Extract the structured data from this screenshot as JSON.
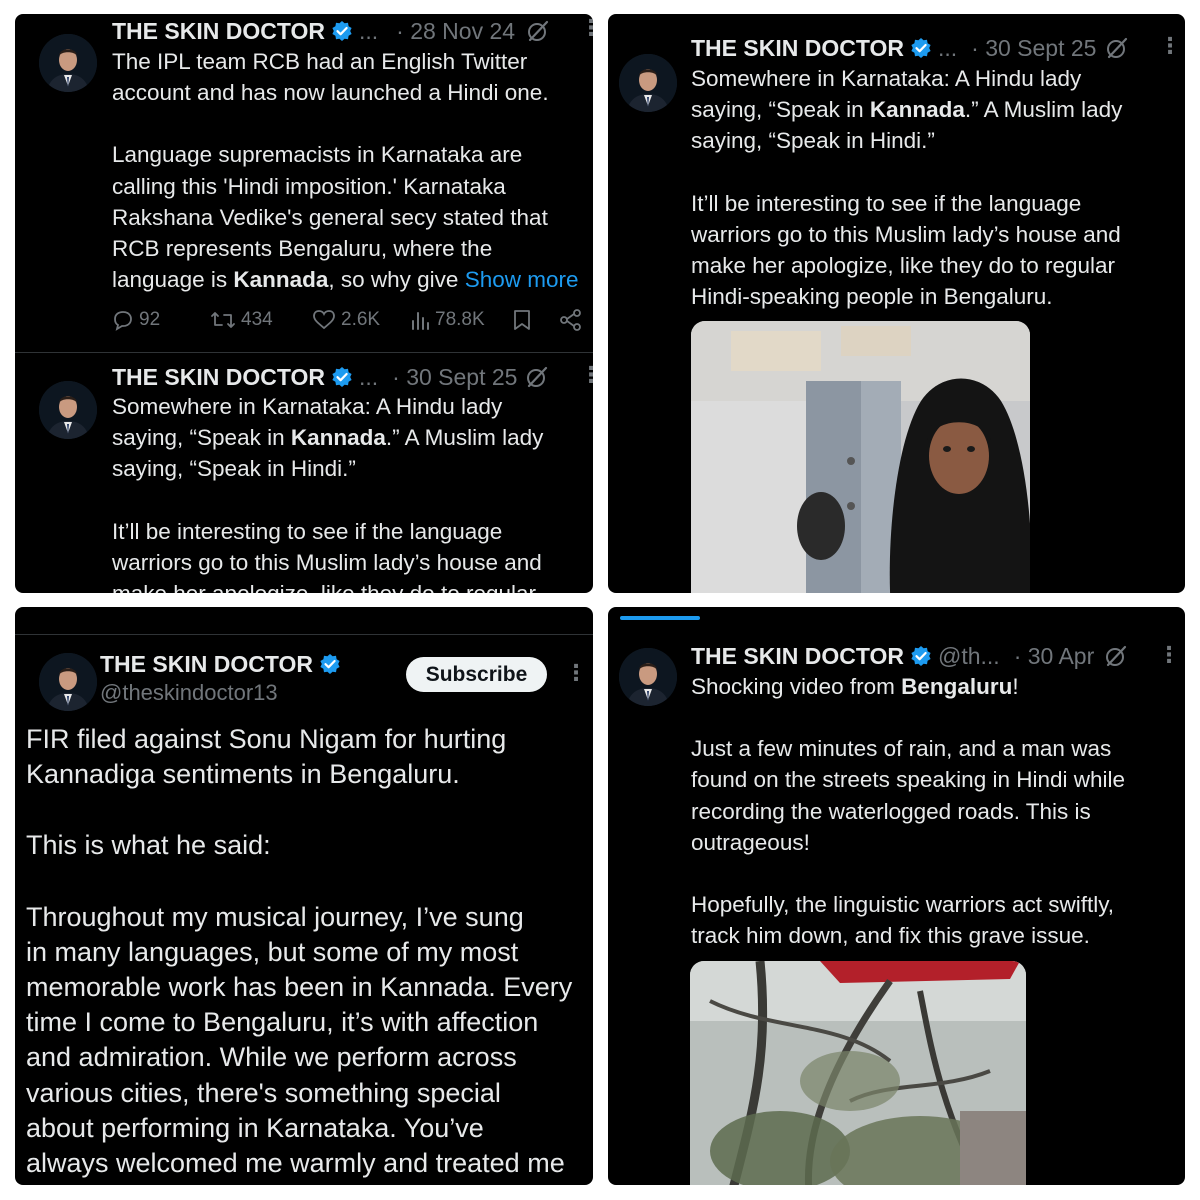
{
  "colors": {
    "accent": "#1d9bf0",
    "background": "#000000",
    "text": "#e7e9ea",
    "muted": "#71767b"
  },
  "icons": [
    "verified-badge-icon",
    "grok-icon",
    "more-options-icon",
    "reply-icon",
    "retweet-icon",
    "like-icon",
    "views-icon",
    "bookmark-icon",
    "share-icon"
  ],
  "panel1": {
    "tweet1": {
      "name": "THE SKIN DOCTOR",
      "handle": "...",
      "time": "· 28 Nov 24",
      "line1": "The IPL team RCB had an English Twitter",
      "line2": "account and has now launched a Hindi one.",
      "line3": "Language supremacists in Karnataka are",
      "line4": "calling this 'Hindi imposition.' Karnataka",
      "line5": "Rakshana Vedike's general secy stated that",
      "line6": "RCB represents Bengaluru, where the",
      "line7a": "language is ",
      "line7b": "Kannada",
      "line7c": ", so why give ",
      "show_more": "Show more",
      "replies": "92",
      "reposts": "434",
      "likes": "2.6K",
      "views": "78.8K"
    },
    "tweet2": {
      "name": "THE SKIN DOCTOR",
      "handle": "...",
      "time": "· 30 Sept 25",
      "line1": "Somewhere in Karnataka: A Hindu lady",
      "line2a": "saying, “Speak in ",
      "line2b": "Kannada",
      "line2c": ".” A Muslim lady",
      "line3": "saying, “Speak in Hindi.”",
      "line4": "It’ll be interesting to see if the language",
      "line5": "warriors go to this Muslim lady’s house and",
      "line6": "make her apologize, like they do to regular"
    }
  },
  "panel2": {
    "name": "THE SKIN DOCTOR",
    "handle": "...",
    "time": "· 30 Sept 25",
    "line1": "Somewhere in Karnataka: A Hindu lady",
    "line2a": "saying, “Speak in ",
    "line2b": "Kannada",
    "line2c": ".” A Muslim lady",
    "line3": "saying, “Speak in Hindi.”",
    "line4": "It’ll be interesting to see if the language",
    "line5": "warriors go to this Muslim lady’s house and",
    "line6": "make her apologize, like they do to regular",
    "line7": "Hindi-speaking people in Bengaluru."
  },
  "panel3": {
    "name": "THE SKIN DOCTOR",
    "handle": "@theskindoctor13",
    "subscribe": "Subscribe",
    "line1": "FIR filed against Sonu Nigam for hurting",
    "line2": "Kannadiga sentiments in Bengaluru.",
    "line3": "This is what he said:",
    "line4": "Throughout my musical journey, I’ve sung",
    "line5": "in many languages, but some of my most",
    "line6": "memorable work has been in Kannada. Every",
    "line7": "time I come to Bengaluru, it’s with affection",
    "line8": "and admiration. While we perform across",
    "line9": "various cities, there's something special",
    "line10": "about performing in Karnataka. You’ve",
    "line11": "always welcomed me warmly and treated me"
  },
  "panel4": {
    "name": "THE SKIN DOCTOR",
    "handle": "@th...",
    "time": "· 30 Apr",
    "line1a": "Shocking video from ",
    "line1b": "Bengaluru",
    "line1c": "!",
    "line2": "Just a few minutes of rain, and a man was",
    "line3": "found on the streets speaking in Hindi while",
    "line4": "recording the waterlogged roads. This is",
    "line5": "outrageous!",
    "line6": "Hopefully, the linguistic warriors act swiftly,",
    "line7": "track him down, and fix this grave issue."
  }
}
